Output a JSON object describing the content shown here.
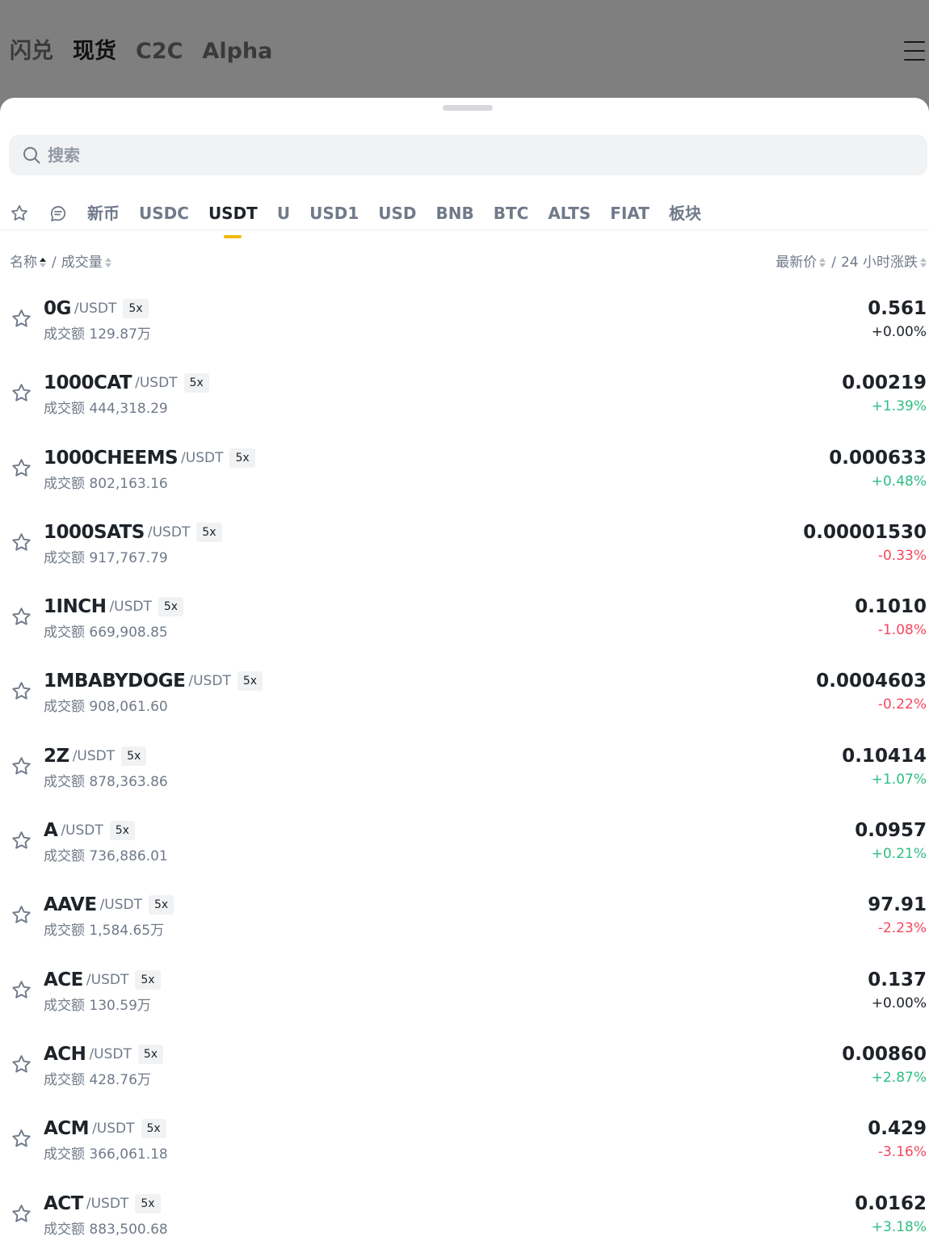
{
  "top_nav": {
    "tabs": [
      {
        "label": "闪兑",
        "active": false
      },
      {
        "label": "现货",
        "active": true
      },
      {
        "label": "C2C",
        "active": false
      },
      {
        "label": "Alpha",
        "active": false
      }
    ],
    "menu_icon": "hamburger-menu-icon"
  },
  "search": {
    "placeholder": "搜索",
    "value": "",
    "icon": "search-icon"
  },
  "quote_tabs": {
    "icon_tabs": [
      "star-icon",
      "chat-bubble-icon"
    ],
    "labels": [
      "新币",
      "USDC",
      "USDT",
      "U",
      "USD1",
      "USD",
      "BNB",
      "BTC",
      "ALTS",
      "FIAT",
      "板块"
    ],
    "active": "USDT"
  },
  "columns": {
    "name": "名称",
    "separator": "/",
    "volume": "成交量",
    "price": "最新价",
    "change": "24 小时涨跌"
  },
  "colors": {
    "up": "#2ebd85",
    "down": "#f6465d",
    "accent": "#f0b90b"
  },
  "pairs": [
    {
      "symbol": "0G",
      "quote": "/USDT",
      "leverage": "5x",
      "volume_label": "成交额",
      "volume": "129.87万",
      "price": "0.561",
      "change": "+0.00%",
      "direction": "flat"
    },
    {
      "symbol": "1000CAT",
      "quote": "/USDT",
      "leverage": "5x",
      "volume_label": "成交额",
      "volume": "444,318.29",
      "price": "0.00219",
      "change": "+1.39%",
      "direction": "up"
    },
    {
      "symbol": "1000CHEEMS",
      "quote": "/USDT",
      "leverage": "5x",
      "volume_label": "成交额",
      "volume": "802,163.16",
      "price": "0.000633",
      "change": "+0.48%",
      "direction": "up"
    },
    {
      "symbol": "1000SATS",
      "quote": "/USDT",
      "leverage": "5x",
      "volume_label": "成交额",
      "volume": "917,767.79",
      "price": "0.00001530",
      "change": "-0.33%",
      "direction": "down"
    },
    {
      "symbol": "1INCH",
      "quote": "/USDT",
      "leverage": "5x",
      "volume_label": "成交额",
      "volume": "669,908.85",
      "price": "0.1010",
      "change": "-1.08%",
      "direction": "down"
    },
    {
      "symbol": "1MBABYDOGE",
      "quote": "/USDT",
      "leverage": "5x",
      "volume_label": "成交额",
      "volume": "908,061.60",
      "price": "0.0004603",
      "change": "-0.22%",
      "direction": "down"
    },
    {
      "symbol": "2Z",
      "quote": "/USDT",
      "leverage": "5x",
      "volume_label": "成交额",
      "volume": "878,363.86",
      "price": "0.10414",
      "change": "+1.07%",
      "direction": "up"
    },
    {
      "symbol": "A",
      "quote": "/USDT",
      "leverage": "5x",
      "volume_label": "成交额",
      "volume": "736,886.01",
      "price": "0.0957",
      "change": "+0.21%",
      "direction": "up"
    },
    {
      "symbol": "AAVE",
      "quote": "/USDT",
      "leverage": "5x",
      "volume_label": "成交额",
      "volume": "1,584.65万",
      "price": "97.91",
      "change": "-2.23%",
      "direction": "down"
    },
    {
      "symbol": "ACE",
      "quote": "/USDT",
      "leverage": "5x",
      "volume_label": "成交额",
      "volume": "130.59万",
      "price": "0.137",
      "change": "+0.00%",
      "direction": "flat"
    },
    {
      "symbol": "ACH",
      "quote": "/USDT",
      "leverage": "5x",
      "volume_label": "成交额",
      "volume": "428.76万",
      "price": "0.00860",
      "change": "+2.87%",
      "direction": "up"
    },
    {
      "symbol": "ACM",
      "quote": "/USDT",
      "leverage": "5x",
      "volume_label": "成交额",
      "volume": "366,061.18",
      "price": "0.429",
      "change": "-3.16%",
      "direction": "down"
    },
    {
      "symbol": "ACT",
      "quote": "/USDT",
      "leverage": "5x",
      "volume_label": "成交额",
      "volume": "883,500.68",
      "price": "0.0162",
      "change": "+3.18%",
      "direction": "up"
    }
  ]
}
